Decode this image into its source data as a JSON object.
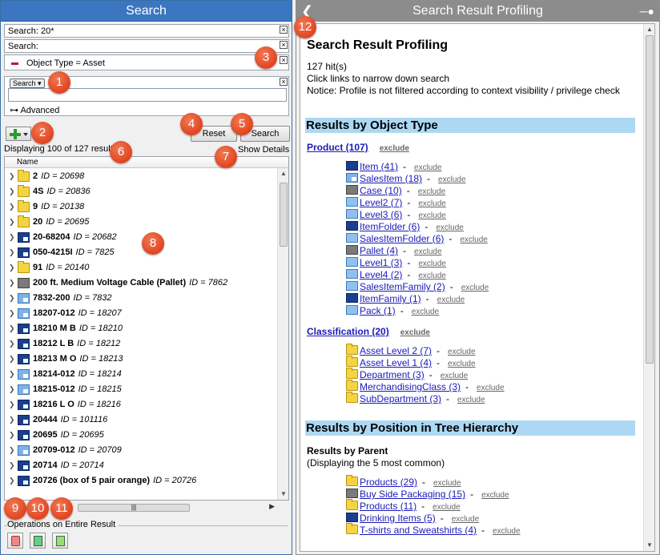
{
  "left": {
    "title": "Search",
    "criteria": [
      "Search: 20*",
      "Search:",
      "Object Type = Asset"
    ],
    "search_dropdown": "Search",
    "search_value": "",
    "advanced_label": "Advanced",
    "reset_label": "Reset",
    "search_label": "Search",
    "displaying": "Displaying 100 of 127 results",
    "show_details": "Show Details",
    "column_header": "Name",
    "rows": [
      {
        "name": "2",
        "id": "ID = 20698",
        "icon": "folder-icon"
      },
      {
        "name": "4S",
        "id": "ID = 20836",
        "icon": "folder-icon"
      },
      {
        "name": "9",
        "id": "ID = 20138",
        "icon": "folder-icon"
      },
      {
        "name": "20",
        "id": "ID = 20695",
        "icon": "folder-icon"
      },
      {
        "name": "20-68204",
        "id": "ID = 20682",
        "icon": "dark-item-icon"
      },
      {
        "name": "050-4215I",
        "id": "ID = 7825",
        "icon": "dark-item-icon"
      },
      {
        "name": "91",
        "id": "ID = 20140",
        "icon": "folder-icon"
      },
      {
        "name": "200 ft. Medium Voltage Cable (Pallet)",
        "id": "ID = 7862",
        "icon": "gray-case-icon"
      },
      {
        "name": "7832-200",
        "id": "ID = 7832",
        "icon": "light-item-icon"
      },
      {
        "name": "18207-012",
        "id": "ID = 18207",
        "icon": "light-item-icon"
      },
      {
        "name": "18210 M B",
        "id": "ID = 18210",
        "icon": "dark-item-icon"
      },
      {
        "name": "18212 L B",
        "id": "ID = 18212",
        "icon": "dark-item-icon"
      },
      {
        "name": "18213 M O",
        "id": "ID = 18213",
        "icon": "dark-item-icon"
      },
      {
        "name": "18214-012",
        "id": "ID = 18214",
        "icon": "light-item-icon"
      },
      {
        "name": "18215-012",
        "id": "ID = 18215",
        "icon": "light-item-icon"
      },
      {
        "name": "18216 L O",
        "id": "ID = 18216",
        "icon": "dark-item-icon"
      },
      {
        "name": "20444",
        "id": "ID = 101116",
        "icon": "dark-item-icon"
      },
      {
        "name": "20695",
        "id": "ID = 20695",
        "icon": "dark-item-icon"
      },
      {
        "name": "20709-012",
        "id": "ID = 20709",
        "icon": "light-item-icon"
      },
      {
        "name": "20714",
        "id": "ID = 20714",
        "icon": "dark-item-icon"
      },
      {
        "name": "20726 (box of 5 pair orange)",
        "id": "ID = 20726",
        "icon": "dark-item-icon"
      }
    ],
    "ops_label": "Operations on Entire Result",
    "badges": [
      "1",
      "2",
      "3",
      "4",
      "5",
      "6",
      "7",
      "8",
      "9",
      "10",
      "11",
      "12"
    ]
  },
  "right": {
    "title": "Search Result Profiling",
    "heading": "Search Result Profiling",
    "hits": "127 hit(s)",
    "hint": "Click links to narrow down search",
    "notice": "Notice: Profile is not filtered according to context visibility / privilege check",
    "exclude": "exclude",
    "section1": "Results by Object Type",
    "product_group": "Product (107)",
    "product_items": [
      {
        "label": "Item (41)",
        "icon": "navy-folder-icon"
      },
      {
        "label": "SalesItem (18)",
        "icon": "light-item-icon"
      },
      {
        "label": "Case (10)",
        "icon": "gray-case-icon"
      },
      {
        "label": "Level2 (7)",
        "icon": "light-folder-icon"
      },
      {
        "label": "Level3 (6)",
        "icon": "light-folder-icon"
      },
      {
        "label": "ItemFolder (6)",
        "icon": "navy-folder-icon"
      },
      {
        "label": "SalesItemFolder (6)",
        "icon": "light-folder-icon"
      },
      {
        "label": "Pallet (4)",
        "icon": "gray-case-icon"
      },
      {
        "label": "Level1 (3)",
        "icon": "light-folder-icon"
      },
      {
        "label": "Level4 (2)",
        "icon": "light-folder-icon"
      },
      {
        "label": "SalesItemFamily (2)",
        "icon": "light-folder-icon"
      },
      {
        "label": "ItemFamily (1)",
        "icon": "navy-folder-icon"
      },
      {
        "label": "Pack (1)",
        "icon": "light-folder-icon"
      }
    ],
    "class_group": "Classification (20)",
    "class_items": [
      {
        "label": "Asset Level 2 (7)",
        "icon": "folder-icon"
      },
      {
        "label": "Asset Level 1 (4)",
        "icon": "folder-icon"
      },
      {
        "label": "Department (3)",
        "icon": "folder-icon"
      },
      {
        "label": "MerchandisingClass (3)",
        "icon": "folder-icon"
      },
      {
        "label": "SubDepartment (3)",
        "icon": "folder-icon"
      }
    ],
    "section2": "Results by Position in Tree Hierarchy",
    "parent_heading": "Results by Parent",
    "parent_note": "(Displaying the 5 most common)",
    "parent_items": [
      {
        "label": "Products (29)",
        "icon": "folder-icon"
      },
      {
        "label": "Buy Side Packaging (15)",
        "icon": "gray-case-icon"
      },
      {
        "label": "Products (11)",
        "icon": "folder-icon"
      },
      {
        "label": "Drinking Items (5)",
        "icon": "navy-folder-icon"
      },
      {
        "label": "T-shirts and Sweatshirts (4)",
        "icon": "folder-icon"
      }
    ]
  }
}
